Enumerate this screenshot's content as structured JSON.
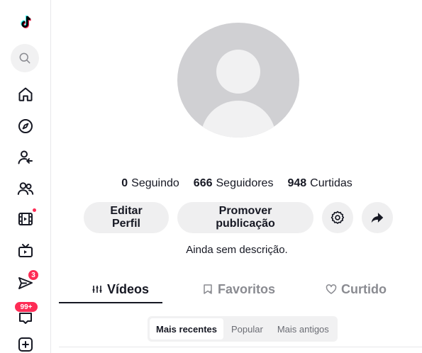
{
  "sidebar": {
    "items": [
      {
        "name": "tiktok-logo-icon"
      },
      {
        "name": "search-icon"
      },
      {
        "name": "home-icon"
      },
      {
        "name": "explore-icon"
      },
      {
        "name": "following-icon"
      },
      {
        "name": "friends-icon"
      },
      {
        "name": "live-icon"
      },
      {
        "name": "tv-icon"
      },
      {
        "name": "messages-icon"
      },
      {
        "name": "inbox-icon"
      },
      {
        "name": "upload-icon"
      }
    ],
    "messages_badge": "3",
    "inbox_badge": "99+"
  },
  "profile": {
    "following_count": "0",
    "following_label": "Seguindo",
    "followers_count": "666",
    "followers_label": "Seguidores",
    "likes_count": "948",
    "likes_label": "Curtidas",
    "bio": "Ainda sem descrição."
  },
  "actions": {
    "edit_label": "Editar Perfil",
    "promote_label": "Promover publicação"
  },
  "tabs": [
    {
      "label": "Vídeos",
      "active": true
    },
    {
      "label": "Favoritos",
      "active": false
    },
    {
      "label": "Curtido",
      "active": false
    }
  ],
  "filters": [
    {
      "label": "Mais recentes",
      "active": true
    },
    {
      "label": "Popular",
      "active": false
    },
    {
      "label": "Mais antigos",
      "active": false
    }
  ],
  "colors": {
    "accent": "#fe2c55",
    "teal": "#25f4ee",
    "text": "#161823",
    "muted": "#8a8b91",
    "button_bg": "#efeff0"
  }
}
